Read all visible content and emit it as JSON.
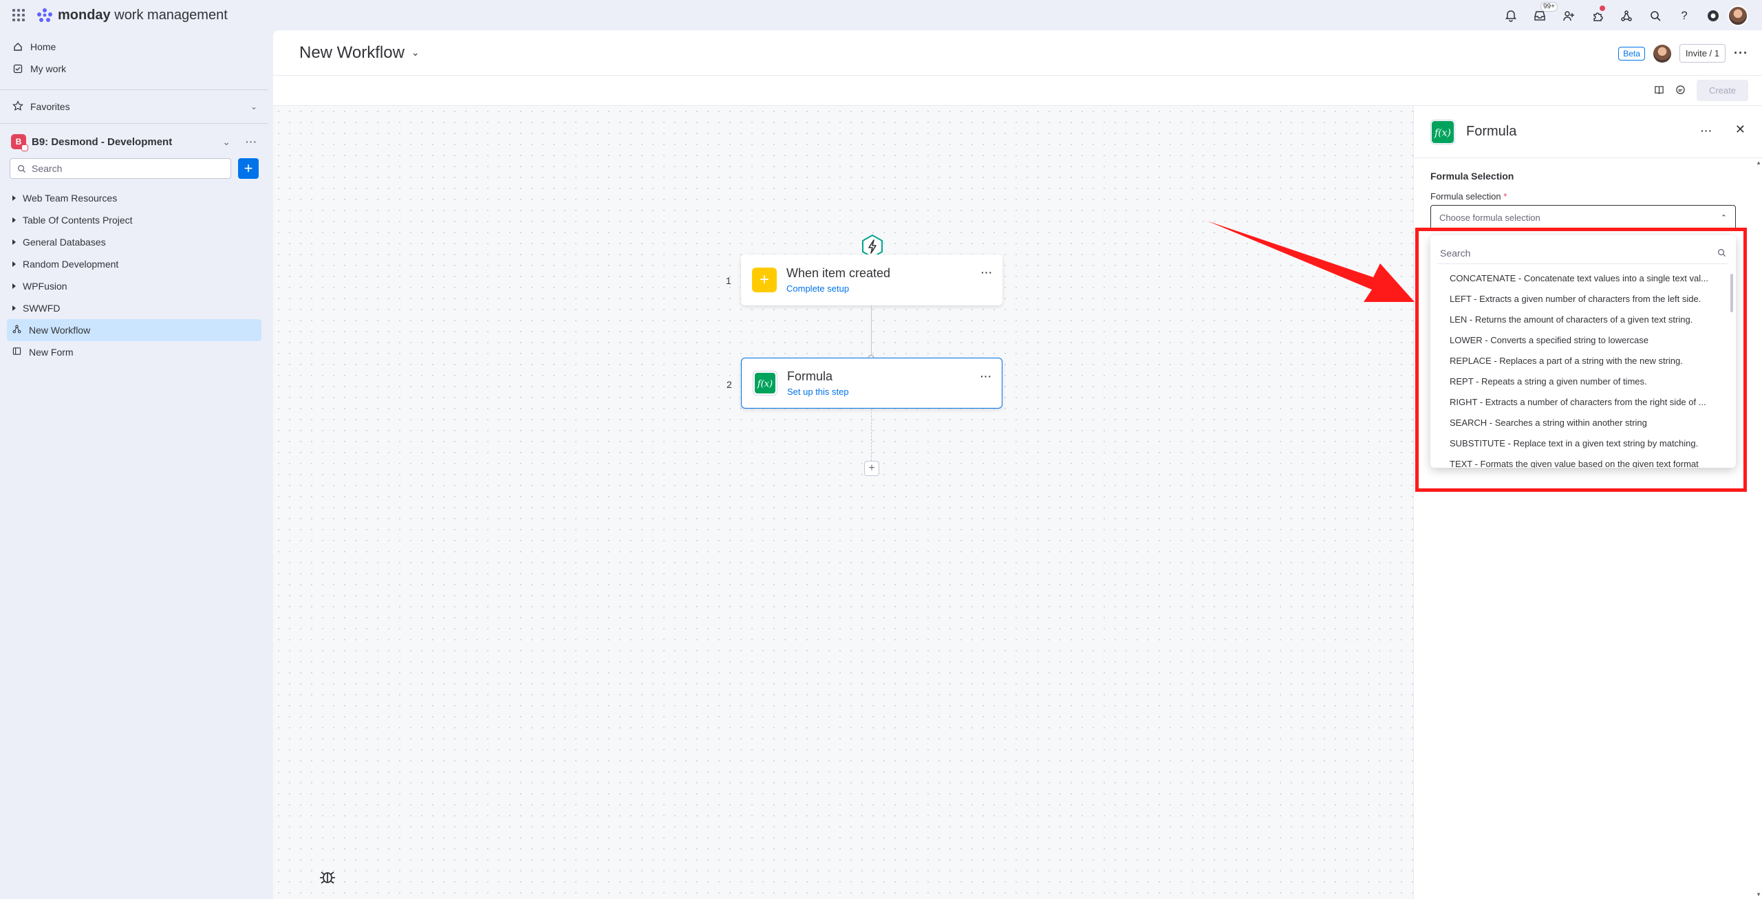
{
  "app": {
    "brand_bold": "monday",
    "brand_rest": " work management"
  },
  "topbar": {
    "inbox_badge": "99+",
    "icons": [
      "notifications-icon",
      "inbox-icon",
      "invite-members-icon",
      "apps-icon",
      "integrations-icon",
      "search-icon",
      "help-icon",
      "monday-ai-icon"
    ]
  },
  "sidebar": {
    "home": "Home",
    "my_work": "My work",
    "favorites": "Favorites",
    "workspace": {
      "initial": "B",
      "name": "B9: Desmond - Development"
    },
    "search_placeholder": "Search",
    "items": [
      {
        "label": "Web Team Resources",
        "type": "folder"
      },
      {
        "label": "Table Of Contents Project",
        "type": "folder"
      },
      {
        "label": "General Databases",
        "type": "folder"
      },
      {
        "label": "Random Development",
        "type": "folder"
      },
      {
        "label": "WPFusion",
        "type": "folder"
      },
      {
        "label": "SWWFD",
        "type": "folder"
      },
      {
        "label": "New Workflow",
        "type": "workflow",
        "active": true
      },
      {
        "label": "New Form",
        "type": "form"
      }
    ]
  },
  "header": {
    "title": "New Workflow",
    "beta": "Beta",
    "invite": "Invite / 1",
    "create": "Create"
  },
  "workflow": {
    "nodes": [
      {
        "number": "1",
        "title": "When item created",
        "subtitle": "Complete setup"
      },
      {
        "number": "2",
        "title": "Formula",
        "subtitle": "Set up this step"
      }
    ]
  },
  "panel": {
    "title": "Formula",
    "section_title": "Formula Selection",
    "field_label": "Formula selection",
    "required_mark": "*",
    "select_placeholder": "Choose formula selection",
    "search_placeholder": "Search",
    "options": [
      "CONCATENATE - Concatenate text values into a single text val...",
      "LEFT - Extracts a given number of characters from the left side.",
      "LEN - Returns the amount of characters of a given text string.",
      "LOWER - Converts a specified string to lowercase",
      "REPLACE - Replaces a part of a string with the new string.",
      "REPT - Repeats a string a given number of times.",
      "RIGHT - Extracts a number of characters from the right side of ...",
      "SEARCH - Searches a string within another string",
      "SUBSTITUTE - Replace text in a given text string by matching.",
      "TEXT - Formats the given value based on the given text format"
    ]
  },
  "colors": {
    "accent": "#0073ea",
    "annotation_red": "#ff1a1a",
    "trigger_yellow": "#ffcb00",
    "formula_green": "#00a35c"
  }
}
